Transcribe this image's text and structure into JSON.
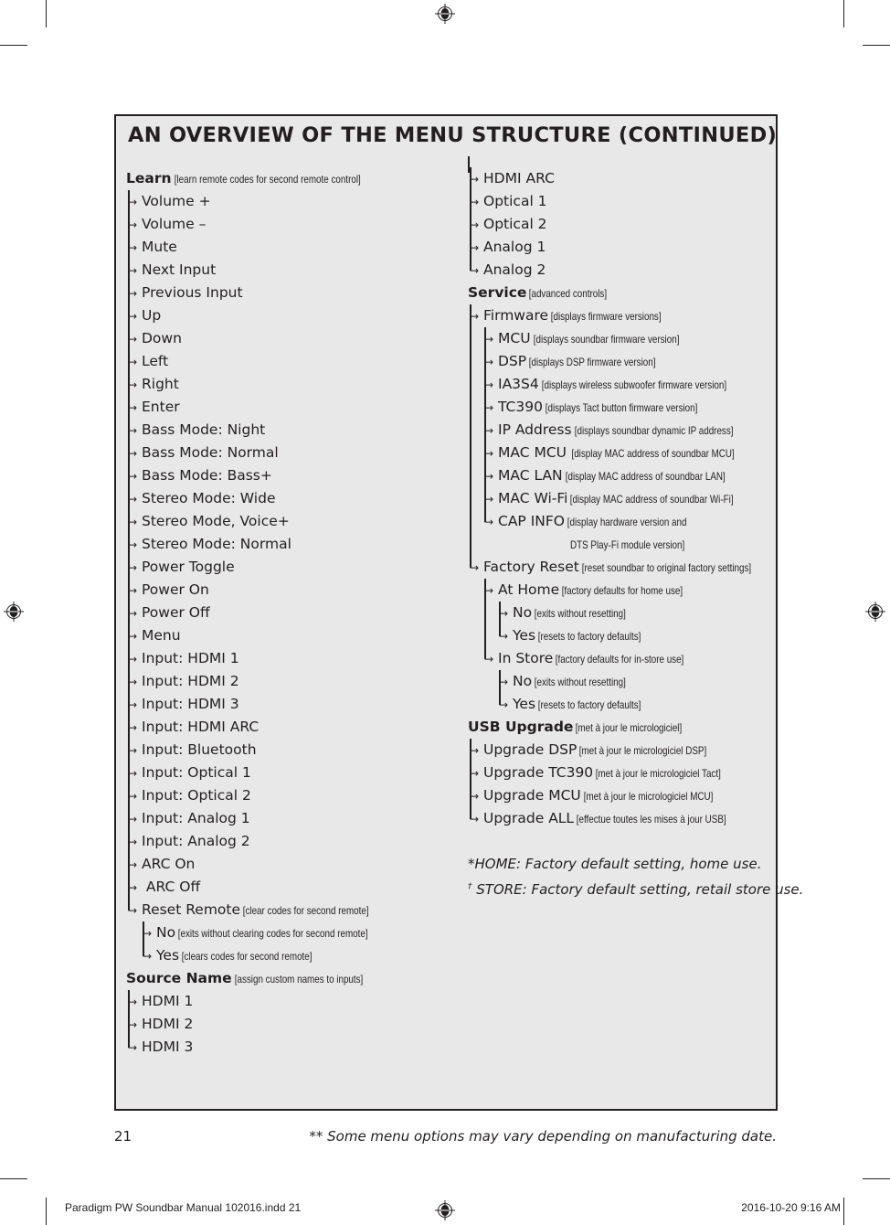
{
  "title": "AN OVERVIEW OF THE MENU STRUCTURE (CONTINUED)",
  "left_column": [
    {
      "label": "Learn",
      "note": "[learn remote codes for second remote control]",
      "level": 0,
      "head": true
    },
    {
      "label": "Volume +",
      "level": 1
    },
    {
      "label": "Volume –",
      "level": 1
    },
    {
      "label": "Mute",
      "level": 1
    },
    {
      "label": "Next Input",
      "level": 1
    },
    {
      "label": "Previous Input",
      "level": 1
    },
    {
      "label": "Up",
      "level": 1
    },
    {
      "label": "Down",
      "level": 1
    },
    {
      "label": "Left",
      "level": 1
    },
    {
      "label": "Right",
      "level": 1
    },
    {
      "label": "Enter",
      "level": 1
    },
    {
      "label": "Bass Mode: Night",
      "level": 1
    },
    {
      "label": "Bass Mode: Normal",
      "level": 1
    },
    {
      "label": "Bass Mode: Bass+",
      "level": 1
    },
    {
      "label": "Stereo Mode: Wide",
      "level": 1
    },
    {
      "label": "Stereo Mode, Voice+",
      "level": 1
    },
    {
      "label": "Stereo Mode: Normal",
      "level": 1
    },
    {
      "label": "Power Toggle",
      "level": 1
    },
    {
      "label": "Power On",
      "level": 1
    },
    {
      "label": "Power Off",
      "level": 1
    },
    {
      "label": "Menu",
      "level": 1
    },
    {
      "label": "Input: HDMI 1",
      "level": 1
    },
    {
      "label": "Input: HDMI 2",
      "level": 1
    },
    {
      "label": "Input: HDMI 3",
      "level": 1
    },
    {
      "label": "Input: HDMI ARC",
      "level": 1
    },
    {
      "label": "Input: Bluetooth",
      "level": 1
    },
    {
      "label": "Input: Optical 1",
      "level": 1
    },
    {
      "label": "Input: Optical 2",
      "level": 1
    },
    {
      "label": "Input: Analog 1",
      "level": 1
    },
    {
      "label": "Input: Analog 2",
      "level": 1
    },
    {
      "label": "ARC On",
      "level": 1
    },
    {
      "label": " ARC Off",
      "level": 1
    },
    {
      "label": "Reset Remote",
      "note": "[clear codes for second remote]",
      "level": 1
    },
    {
      "label": "No",
      "note": "[exits without clearing codes for second remote]",
      "level": 2
    },
    {
      "label": "Yes",
      "note": "[clears codes for second remote]",
      "level": 2
    },
    {
      "label": "Source Name",
      "note": "[assign custom names to inputs]",
      "level": 0,
      "head": true
    },
    {
      "label": "HDMI 1",
      "level": 1
    },
    {
      "label": "HDMI 2",
      "level": 1
    },
    {
      "label": "HDMI 3",
      "level": 1
    }
  ],
  "right_column": [
    {
      "label": "HDMI ARC",
      "level": 1
    },
    {
      "label": "Optical 1",
      "level": 1
    },
    {
      "label": "Optical 2",
      "level": 1
    },
    {
      "label": "Analog 1",
      "level": 1
    },
    {
      "label": "Analog 2",
      "level": 1
    },
    {
      "label": "Service",
      "note": "[advanced controls]",
      "level": 0,
      "head": true
    },
    {
      "label": "Firmware",
      "note": "[displays firmware versions]",
      "level": 1
    },
    {
      "label": "MCU",
      "note": "[displays soundbar firmware version]",
      "level": 2
    },
    {
      "label": "DSP",
      "note": "[displays DSP firmware version]",
      "level": 2
    },
    {
      "label": "IA3S4",
      "note": "[displays wireless subwoofer firmware version]",
      "level": 2
    },
    {
      "label": "TC390",
      "note": "[displays Tact button firmware version]",
      "level": 2
    },
    {
      "label": "IP Address",
      "note": "[displays soundbar dynamic IP address]",
      "level": 2
    },
    {
      "label": "MAC MCU",
      "note": " [display MAC address of soundbar MCU]",
      "level": 2
    },
    {
      "label": "MAC LAN",
      "note": "[display MAC address of soundbar LAN]",
      "level": 2
    },
    {
      "label": "MAC Wi-Fi",
      "note": "[display MAC address of soundbar Wi-Fi]",
      "level": 2
    },
    {
      "label": "CAP INFO",
      "note": "[display hardware version and",
      "level": 2
    },
    {
      "label": "",
      "note": "DTS Play-Fi module version]",
      "level": 5
    },
    {
      "label": "Factory Reset",
      "note": "[reset soundbar to original factory settings]",
      "level": 1
    },
    {
      "label": "At Home",
      "note": "[factory defaults for home use]",
      "level": 2
    },
    {
      "label": "No",
      "note": "[exits without resetting]",
      "level": 3
    },
    {
      "label": "Yes",
      "note": "[resets to factory defaults]",
      "level": 3
    },
    {
      "label": "In Store",
      "note": "[factory defaults for in-store use]",
      "level": 2
    },
    {
      "label": "No",
      "note": "[exits without resetting]",
      "level": 3
    },
    {
      "label": "Yes",
      "note": "[resets to factory defaults]",
      "level": 3
    },
    {
      "label": "USB Upgrade",
      "note": "[met à jour le micrologiciel]",
      "level": 0,
      "head": true
    },
    {
      "label": "Upgrade DSP",
      "note": "[met à jour le micrologiciel DSP]",
      "level": 1
    },
    {
      "label": "Upgrade TC390",
      "note": "[met à jour le micrologiciel Tact]",
      "level": 1
    },
    {
      "label": "Upgrade MCU",
      "note": "[met à jour le micrologiciel MCU]",
      "level": 1
    },
    {
      "label": "Upgrade ALL",
      "note": "[effectue toutes les mises à jour USB]",
      "level": 1
    }
  ],
  "footnotes": {
    "home": "*HOME: Factory default setting, home use.",
    "store_mark": "†",
    "store": " STORE: Factory default setting, retail store use."
  },
  "page_number": "21",
  "disclaimer": "** Some menu options may vary depending on manufacturing date.",
  "slug": {
    "file": "Paradigm PW Soundbar Manual 102016.indd   21",
    "datetime": "2016-10-20   9:16 AM"
  },
  "arrow_glyph": "→"
}
